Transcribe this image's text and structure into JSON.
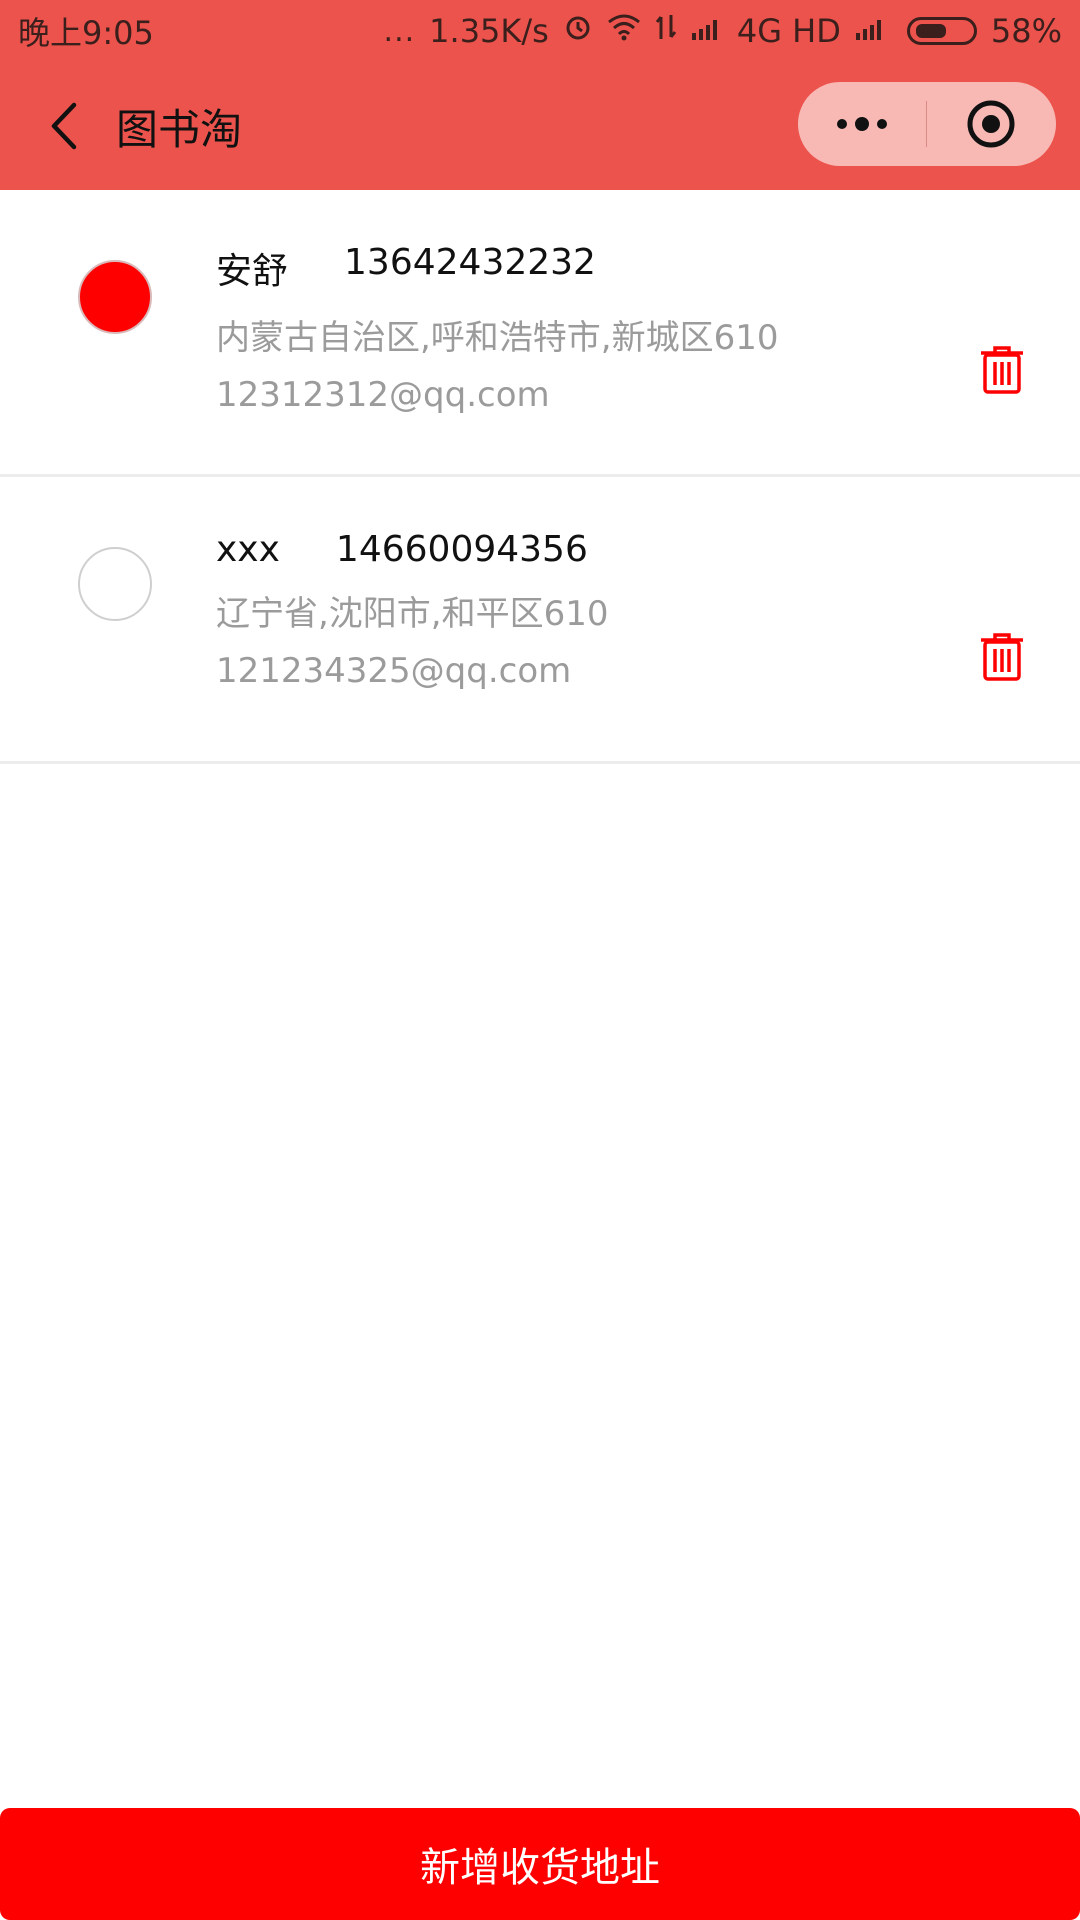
{
  "status_bar": {
    "time": "晚上9:05",
    "dots": "...",
    "speed": "1.35K/s",
    "network": "4G HD",
    "battery": "58%",
    "battery_level": 0.58,
    "icons": [
      "alarm-icon",
      "wifi-icon",
      "data-arrows-icon",
      "signal-icon",
      "signal-icon-2",
      "battery-icon"
    ]
  },
  "header": {
    "title": "图书淘",
    "back_icon": "chevron-left-icon",
    "capsule": {
      "more_icon": "more-dots-icon",
      "close_icon": "record-target-icon"
    },
    "color": "#eb534c"
  },
  "addresses": [
    {
      "name": "安舒",
      "phone": "13642432232",
      "address": "内蒙古自治区,呼和浩特市,新城区610",
      "email": "12312312@qq.com",
      "selected": true
    },
    {
      "name": "xxx",
      "phone": "14660094356",
      "address": "辽宁省,沈阳市,和平区610",
      "email": "121234325@qq.com",
      "selected": false
    }
  ],
  "footer": {
    "add_button_label": "新增收货地址",
    "accent": "#ff0000"
  }
}
